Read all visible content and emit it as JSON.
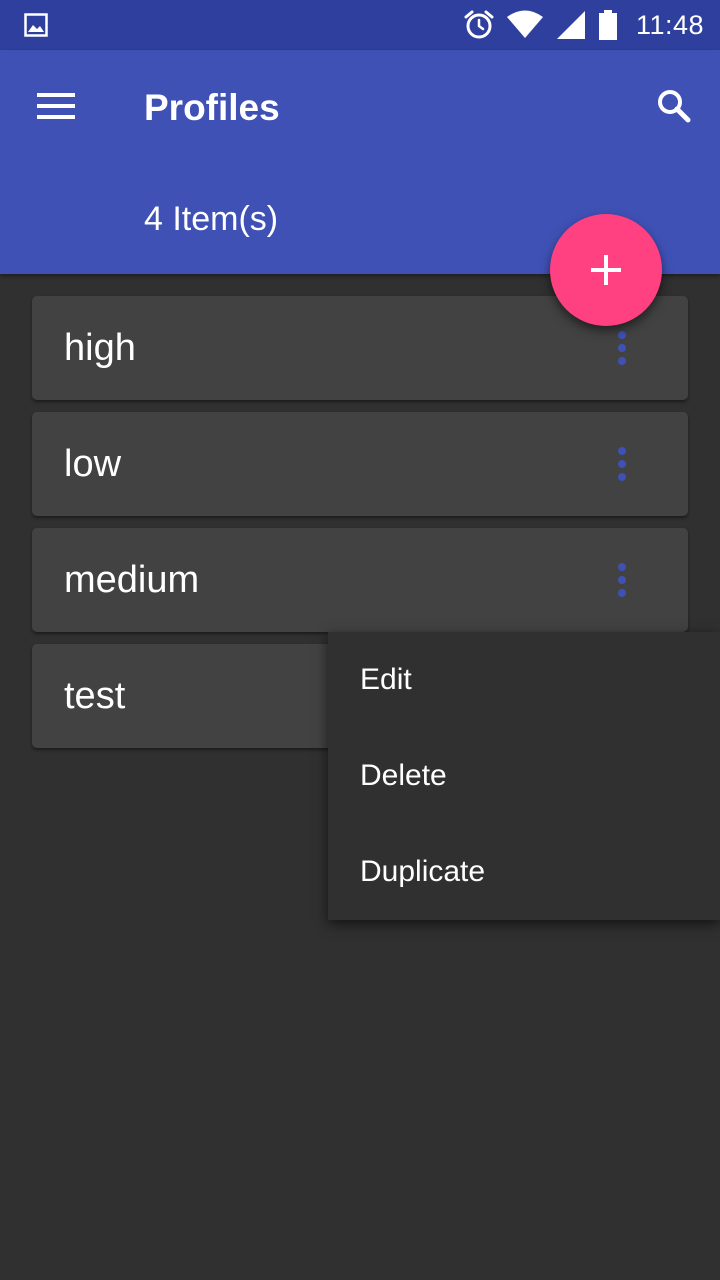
{
  "status_bar": {
    "time": "11:48",
    "icons": [
      "gallery-icon",
      "alarm-icon",
      "wifi-icon",
      "signal-icon",
      "battery-icon"
    ]
  },
  "app_bar": {
    "title": "Profiles",
    "subtitle": "4 Item(s)",
    "menu_icon": "menu-icon",
    "search_icon": "search-icon",
    "color": "#3f51b5"
  },
  "fab": {
    "icon": "plus-icon",
    "color": "#ff4081"
  },
  "profiles": [
    {
      "label": "high"
    },
    {
      "label": "low"
    },
    {
      "label": "medium"
    },
    {
      "label": "test"
    }
  ],
  "popup_menu": {
    "items": [
      {
        "label": "Edit"
      },
      {
        "label": "Delete"
      },
      {
        "label": "Duplicate"
      }
    ]
  },
  "colors": {
    "status_bar": "#2f3f9e",
    "background": "#303030",
    "card": "#424242",
    "more_dots": "#3f51b5"
  }
}
